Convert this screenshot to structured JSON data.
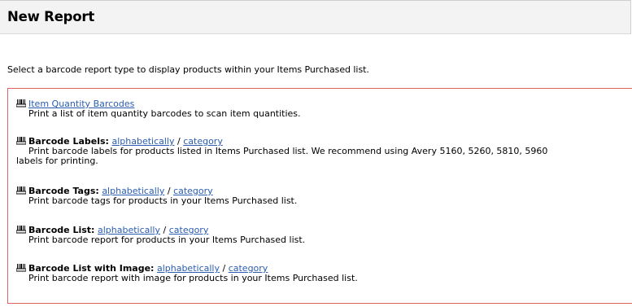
{
  "page": {
    "title": "New Report",
    "intro": "Select a barcode report type to display products within your Items Purchased list."
  },
  "reports": [
    {
      "icon": "barcode-printer-icon",
      "link": "Item Quantity Barcodes",
      "description": "Print a list of item quantity barcodes to scan item quantities."
    },
    {
      "icon": "barcode-printer-icon",
      "title": "Barcode Labels:",
      "link_a": "alphabetically",
      "sep": "/",
      "link_b": "category",
      "description_1": "Print barcode labels for products listed in Items Purchased list. We recommend using Avery 5160, 5260, 5810, 5960",
      "description_2": "labels for printing."
    },
    {
      "icon": "barcode-printer-icon",
      "title": "Barcode Tags:",
      "link_a": "alphabetically",
      "sep": "/",
      "link_b": "category",
      "description": "Print barcode tags for products in your Items Purchased list."
    },
    {
      "icon": "barcode-printer-icon",
      "title": "Barcode List:",
      "link_a": "alphabetically",
      "sep": "/",
      "link_b": "category",
      "description": "Print barcode report for products in your Items Purchased list."
    },
    {
      "icon": "barcode-printer-icon",
      "title": "Barcode List with Image:",
      "link_a": "alphabetically",
      "sep": "/",
      "link_b": "category",
      "description": "Print barcode report with image for products in your Items Purchased list."
    }
  ]
}
